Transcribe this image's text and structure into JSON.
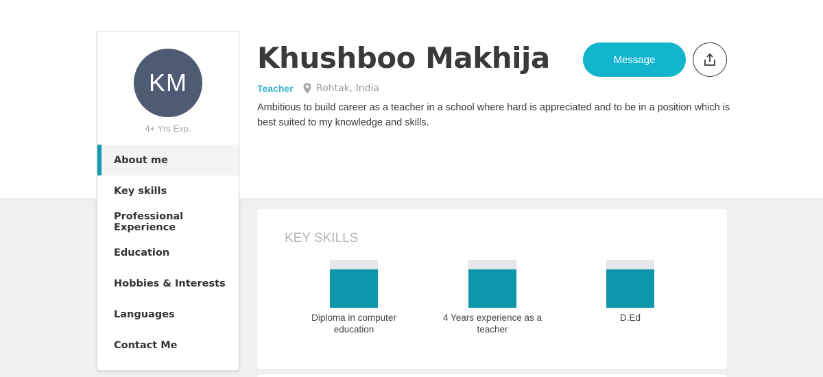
{
  "profile": {
    "initials": "KM",
    "experience": "4+ Yrs Exp.",
    "name": "Khushboo Makhija",
    "role": "Teacher",
    "location": "Rohtak, India",
    "bio": "Ambitious to build career as a teacher in a school where hard is appreciated and to be in a position which is best suited to my knowledge and skills."
  },
  "actions": {
    "message_label": "Message",
    "share_icon": "share-upload-icon"
  },
  "nav": {
    "items": [
      {
        "label": "About me",
        "active": true
      },
      {
        "label": "Key skills",
        "active": false
      },
      {
        "label": "Professional Experience",
        "active": false
      },
      {
        "label": "Education",
        "active": false
      },
      {
        "label": "Hobbies & Interests",
        "active": false
      },
      {
        "label": "Languages",
        "active": false
      },
      {
        "label": "Contact Me",
        "active": false
      }
    ]
  },
  "skills": {
    "title": "KEY SKILLS",
    "items": [
      {
        "label": "Diploma in computer education",
        "level": 0.8
      },
      {
        "label": "4 Years experience as a teacher",
        "level": 0.8
      },
      {
        "label": "D.Ed",
        "level": 0.8
      }
    ]
  },
  "colors": {
    "accent": "#13b5ce",
    "skill_fill": "#0e97ab",
    "avatar_bg": "#4f5a73",
    "role_text": "#3bb3c8"
  }
}
